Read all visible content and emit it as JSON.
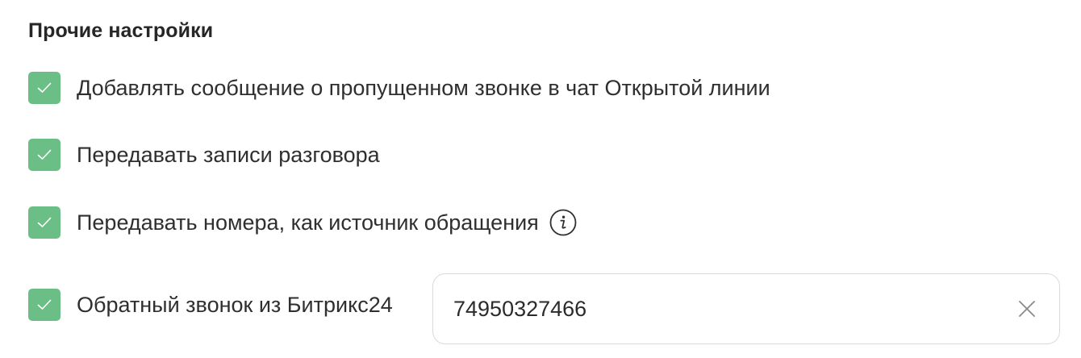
{
  "section": {
    "title": "Прочие настройки"
  },
  "options": [
    {
      "label": "Добавлять сообщение о пропущенном звонке в чат Открытой линии",
      "checked": true
    },
    {
      "label": "Передавать записи разговора",
      "checked": true
    },
    {
      "label": "Передавать номера, как источник обращения",
      "checked": true,
      "icon": "info-icon"
    },
    {
      "label": "Обратный звонок из Битрикс24",
      "checked": true
    }
  ],
  "callback_field": {
    "value": "74950327466",
    "clear_icon": "close-icon"
  },
  "colors": {
    "checkbox": "#6bbf86",
    "text": "#2f2f2f",
    "border": "#dadada"
  }
}
